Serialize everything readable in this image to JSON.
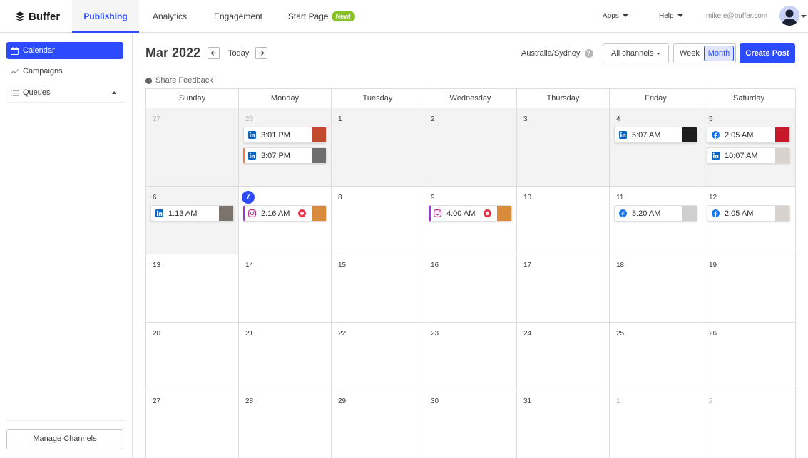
{
  "app": {
    "name": "Buffer"
  },
  "nav": {
    "tabs": [
      {
        "label": "Publishing"
      },
      {
        "label": "Analytics"
      },
      {
        "label": "Engagement"
      },
      {
        "label": "Start Page",
        "badge": "New!"
      }
    ],
    "apps_label": "Apps",
    "help_label": "Help",
    "user_email": "mike.e@buffer.com"
  },
  "sidebar": {
    "items": [
      {
        "label": "Calendar",
        "icon": "calendar-icon"
      },
      {
        "label": "Campaigns",
        "icon": "trend-icon"
      },
      {
        "label": "Queues",
        "icon": "list-icon"
      }
    ],
    "manage_label": "Manage Channels"
  },
  "header": {
    "month": "Mar 2022",
    "today_label": "Today",
    "timezone": "Australia/Sydney",
    "channels_label": "All channels",
    "week_label": "Week",
    "month_label": "Month",
    "create_label": "Create Post",
    "feedback_label": "Share Feedback"
  },
  "calendar": {
    "weekdays": [
      "Sunday",
      "Monday",
      "Tuesday",
      "Wednesday",
      "Thursday",
      "Friday",
      "Saturday"
    ],
    "weeks": [
      [
        {
          "day": "27",
          "past": true,
          "faded": true,
          "posts": []
        },
        {
          "day": "28",
          "past": true,
          "faded": true,
          "posts": [
            {
              "time": "3:01 PM",
              "network": "linkedin",
              "thumb": "#c24a2e"
            },
            {
              "time": "3:07 PM",
              "network": "linkedin",
              "accent": "orange",
              "thumb": "#6e6e6e"
            }
          ]
        },
        {
          "day": "1",
          "past": true,
          "posts": []
        },
        {
          "day": "2",
          "past": true,
          "posts": []
        },
        {
          "day": "3",
          "past": true,
          "posts": []
        },
        {
          "day": "4",
          "past": true,
          "posts": [
            {
              "time": "5:07 AM",
              "network": "linkedin",
              "thumb": "#1e1e1e"
            }
          ]
        },
        {
          "day": "5",
          "past": true,
          "posts": [
            {
              "time": "2:05 AM",
              "network": "facebook",
              "thumb": "#c8182a"
            },
            {
              "time": "10:07 AM",
              "network": "linkedin",
              "thumb": "#d8d2cf"
            }
          ]
        }
      ],
      [
        {
          "day": "6",
          "past": true,
          "posts": [
            {
              "time": "1:13 AM",
              "network": "linkedin",
              "thumb": "#7a746c"
            }
          ]
        },
        {
          "day": "7",
          "today": true,
          "posts": [
            {
              "time": "2:16 AM",
              "network": "instagram",
              "accent": "ig",
              "alert": true,
              "thumb": "#d98a3a"
            }
          ]
        },
        {
          "day": "8",
          "posts": []
        },
        {
          "day": "9",
          "posts": [
            {
              "time": "4:00 AM",
              "network": "instagram",
              "accent": "ig",
              "alert": true,
              "thumb": "#d98a3a"
            }
          ]
        },
        {
          "day": "10",
          "posts": []
        },
        {
          "day": "11",
          "posts": [
            {
              "time": "8:20 AM",
              "network": "facebook",
              "thumb": "#cfcfcf"
            }
          ]
        },
        {
          "day": "12",
          "posts": [
            {
              "time": "2:05 AM",
              "network": "facebook",
              "thumb": "#d8d2cf"
            }
          ]
        }
      ],
      [
        {
          "day": "13",
          "posts": []
        },
        {
          "day": "14",
          "posts": []
        },
        {
          "day": "15",
          "posts": []
        },
        {
          "day": "16",
          "posts": []
        },
        {
          "day": "17",
          "posts": []
        },
        {
          "day": "18",
          "posts": []
        },
        {
          "day": "19",
          "posts": []
        }
      ],
      [
        {
          "day": "20",
          "posts": []
        },
        {
          "day": "21",
          "posts": []
        },
        {
          "day": "22",
          "posts": []
        },
        {
          "day": "23",
          "posts": []
        },
        {
          "day": "24",
          "posts": []
        },
        {
          "day": "25",
          "posts": []
        },
        {
          "day": "26",
          "posts": []
        }
      ],
      [
        {
          "day": "27",
          "posts": []
        },
        {
          "day": "28",
          "posts": []
        },
        {
          "day": "29",
          "posts": []
        },
        {
          "day": "30",
          "posts": []
        },
        {
          "day": "31",
          "posts": []
        },
        {
          "day": "1",
          "faded": true,
          "posts": []
        },
        {
          "day": "2",
          "faded": true,
          "posts": []
        }
      ]
    ]
  },
  "colors": {
    "accent": "#2c4bff",
    "new_badge": "#87c221",
    "linkedin": "#0a66c2",
    "facebook": "#1877f2",
    "instagram": "#a033d9",
    "alert": "#e8344a"
  }
}
